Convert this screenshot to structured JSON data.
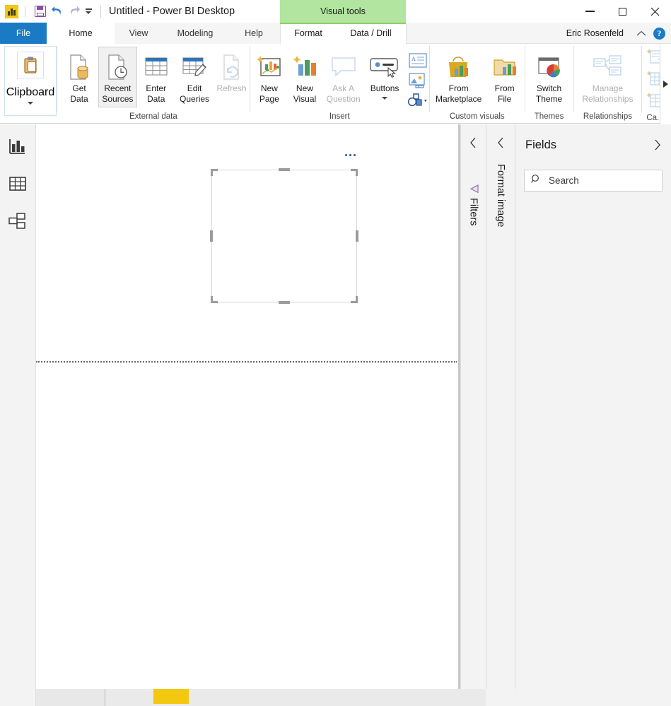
{
  "window": {
    "document_title": "Untitled - Power BI Desktop",
    "app_icon": "power-bi-logo",
    "quick_access": [
      {
        "name": "save-icon",
        "label": "Save"
      },
      {
        "name": "undo-icon",
        "label": "Undo"
      },
      {
        "name": "redo-icon",
        "label": "Redo"
      },
      {
        "name": "customize-quick-access-caret",
        "label": "Customize Quick Access Toolbar"
      }
    ],
    "controls": {
      "minimize": "minimize-icon",
      "maximize": "maximize-icon",
      "close": "close-icon"
    }
  },
  "contextual": {
    "group_title": "Visual tools",
    "accent_color": "#b2e59f"
  },
  "tabs": {
    "file": "File",
    "items": [
      {
        "label": "Home",
        "active": true
      },
      {
        "label": "View",
        "active": false
      },
      {
        "label": "Modeling",
        "active": false
      },
      {
        "label": "Help",
        "active": false
      }
    ],
    "contextual_items": [
      {
        "label": "Format",
        "active": false
      },
      {
        "label": "Data / Drill",
        "active": false
      }
    ]
  },
  "account": {
    "user_name": "Eric Rosenfeld",
    "collapse_ribbon_icon": "chevron-up-icon",
    "help_icon": "help-question-icon"
  },
  "ribbon": {
    "groups": [
      {
        "name": "clipboard",
        "label": "",
        "buttons": [
          {
            "name": "clipboard",
            "label": "Clipboard",
            "icon": "clipboard-icon",
            "has_caret": true,
            "disabled": false,
            "selected": false
          }
        ]
      },
      {
        "name": "external-data",
        "label": "External data",
        "buttons": [
          {
            "name": "get-data",
            "label": "Get\nData",
            "icon": "get-data-icon",
            "has_caret": true,
            "disabled": false,
            "selected": false
          },
          {
            "name": "recent-sources",
            "label": "Recent\nSources",
            "icon": "recent-sources-icon",
            "has_caret": true,
            "disabled": false,
            "selected": true
          },
          {
            "name": "enter-data",
            "label": "Enter\nData",
            "icon": "enter-data-icon",
            "has_caret": false,
            "disabled": false,
            "selected": false
          },
          {
            "name": "edit-queries",
            "label": "Edit\nQueries",
            "icon": "edit-queries-icon",
            "has_caret": true,
            "disabled": false,
            "selected": false
          },
          {
            "name": "refresh",
            "label": "Refresh",
            "icon": "refresh-icon",
            "has_caret": false,
            "disabled": true,
            "selected": false
          }
        ]
      },
      {
        "name": "insert",
        "label": "Insert",
        "buttons": [
          {
            "name": "new-page",
            "label": "New\nPage",
            "icon": "new-page-icon",
            "has_caret": true,
            "disabled": false,
            "selected": false
          },
          {
            "name": "new-visual",
            "label": "New\nVisual",
            "icon": "new-visual-icon",
            "has_caret": false,
            "disabled": false,
            "selected": false
          },
          {
            "name": "ask-a-question",
            "label": "Ask A\nQuestion",
            "icon": "ask-question-icon",
            "has_caret": false,
            "disabled": true,
            "selected": false
          },
          {
            "name": "buttons",
            "label": "Buttons",
            "icon": "buttons-icon",
            "has_caret": true,
            "disabled": false,
            "selected": false
          }
        ],
        "mini_buttons": [
          {
            "name": "text-box",
            "icon": "text-box-icon"
          },
          {
            "name": "image",
            "icon": "image-icon"
          },
          {
            "name": "shapes",
            "icon": "shapes-icon",
            "has_caret": true
          }
        ]
      },
      {
        "name": "custom-visuals",
        "label": "Custom visuals",
        "buttons": [
          {
            "name": "from-marketplace",
            "label": "From\nMarketplace",
            "icon": "marketplace-icon",
            "has_caret": false,
            "disabled": false,
            "selected": false
          },
          {
            "name": "from-file",
            "label": "From\nFile",
            "icon": "from-file-icon",
            "has_caret": false,
            "disabled": false,
            "selected": false
          }
        ]
      },
      {
        "name": "themes",
        "label": "Themes",
        "buttons": [
          {
            "name": "switch-theme",
            "label": "Switch\nTheme",
            "icon": "switch-theme-icon",
            "has_caret": true,
            "disabled": false,
            "selected": false
          }
        ]
      },
      {
        "name": "relationships",
        "label": "Relationships",
        "buttons": [
          {
            "name": "manage-relationships",
            "label": "Manage\nRelationships",
            "icon": "manage-relationships-icon",
            "has_caret": false,
            "disabled": true,
            "selected": false
          }
        ]
      },
      {
        "name": "calculations",
        "label": "Ca.",
        "buttons": []
      }
    ],
    "overflow_icon": "ribbon-overflow-arrow"
  },
  "view_bar": {
    "items": [
      {
        "name": "report-view",
        "icon": "report-chart-icon",
        "active": true
      },
      {
        "name": "data-view",
        "icon": "data-table-icon",
        "active": false
      },
      {
        "name": "model-view",
        "icon": "model-relationship-icon",
        "active": false
      }
    ]
  },
  "canvas": {
    "selected_visual": {
      "name": "image-visual",
      "type": "image",
      "more_options_icon": "more-options-ellipsis",
      "selected": true,
      "handles": [
        "top-left",
        "top-middle",
        "top-right",
        "middle-left",
        "middle-right",
        "bottom-left",
        "bottom-middle",
        "bottom-right"
      ]
    },
    "page_boundary": "dotted-line"
  },
  "panes": {
    "filters": {
      "title": "Filters",
      "collapse_icon": "chevron-left-icon",
      "icon": "filter-funnel-icon",
      "collapsed": true
    },
    "format": {
      "title": "Format image",
      "collapse_icon": "chevron-left-icon",
      "collapsed": true
    },
    "fields": {
      "title": "Fields",
      "expand_icon": "chevron-right-icon",
      "search": {
        "placeholder": "Search",
        "value": "",
        "icon": "search-icon"
      },
      "items": []
    }
  },
  "bottom_bar": {
    "scrollbar": {
      "name": "horizontal-scrollbar",
      "thumb_color": "#f2c811"
    }
  },
  "colors": {
    "file_tab_blue": "#1a7ac4",
    "contextual_green": "#b2e59f",
    "accent_yellow": "#f2c811",
    "ribbon_bg": "#ffffff",
    "pane_bg": "#f3f3f3"
  }
}
